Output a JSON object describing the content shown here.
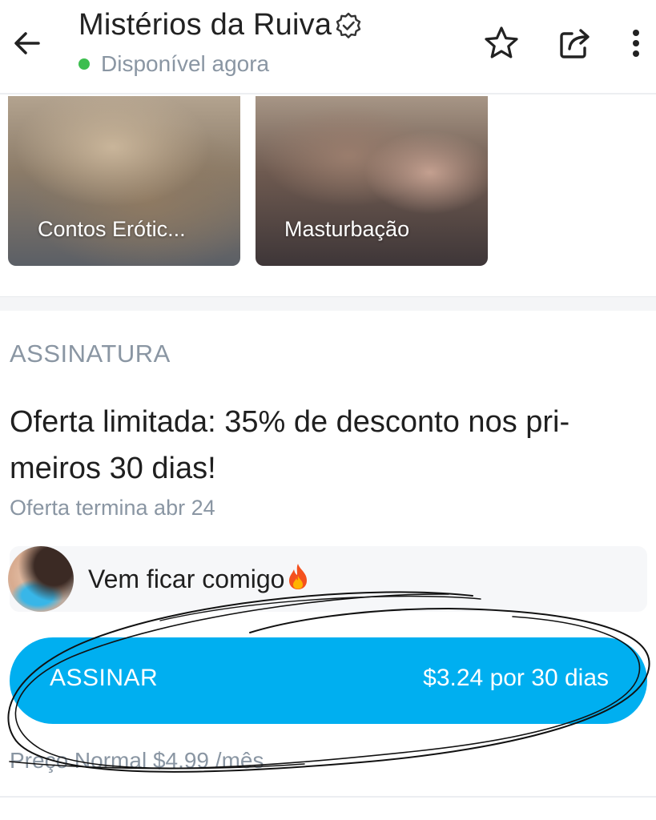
{
  "header": {
    "title": "Mistérios da Ruiva",
    "status": "Disponível agora",
    "status_color": "#3dbe4f",
    "icons": [
      "back-arrow-icon",
      "verified-badge-icon",
      "star-icon",
      "share-icon",
      "more-vertical-icon"
    ]
  },
  "media": {
    "tiles": [
      {
        "label": "Contos Erótic..."
      },
      {
        "label": "Masturbação"
      }
    ]
  },
  "subscription": {
    "section_label": "ASSINATURA",
    "offer_title": "Oferta limitada: 35% de desconto nos pri-meiros 30 dias!",
    "offer_end": "Oferta termina abr 24",
    "message": "Vem ficar comigo",
    "button_label": "ASSINAR",
    "button_price": "$3.24 por 30 dias",
    "regular_price": "Preço Normal $4.99 /mês",
    "accent_color": "#00aff0"
  }
}
